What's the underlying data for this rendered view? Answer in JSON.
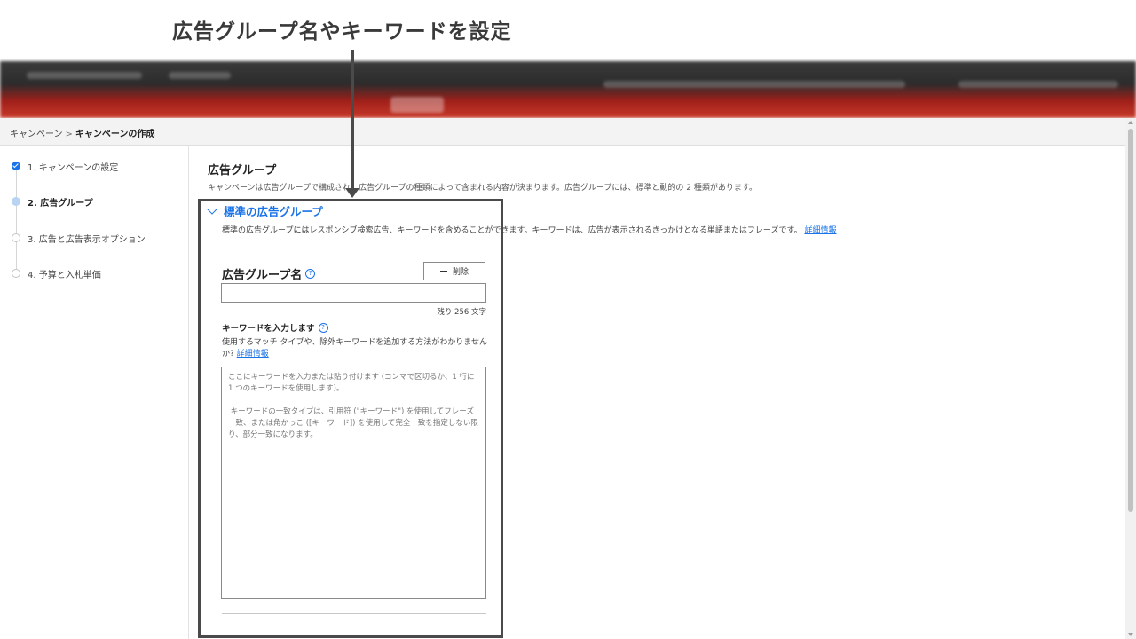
{
  "annotation": {
    "title": "広告グループ名やキーワードを設定"
  },
  "breadcrumb": {
    "parent": "キャンペーン",
    "separator": ">",
    "current": "キャンペーンの作成"
  },
  "steps": [
    {
      "label": "1. キャンペーンの設定",
      "status": "done"
    },
    {
      "label": "2. 広告グループ",
      "status": "active"
    },
    {
      "label": "3. 広告と広告表示オプション",
      "status": "todo"
    },
    {
      "label": "4. 予算と入札単価",
      "status": "todo"
    }
  ],
  "main": {
    "title": "広告グループ",
    "description": "キャンペーンは広告グループで構成され、広告グループの種類によって含まれる内容が決まります。広告グループには、標準と動的の 2 種類があります。"
  },
  "section": {
    "title": "標準の広告グループ",
    "description": "標準の広告グループにはレスポンシブ検索広告、キーワードを含めることができます。キーワードは、広告が表示されるきっかけとなる単語またはフレーズです。",
    "link": "詳細情報"
  },
  "ad_group": {
    "name_label": "広告グループ名",
    "help_icon": "?",
    "delete_label": "削除",
    "name_value": "",
    "char_remaining": "残り 256 文字"
  },
  "keywords": {
    "label": "キーワードを入力します",
    "help_text": "使用するマッチ タイプや、除外キーワードを追加する方法がわかりませんか?",
    "help_link": "詳細情報",
    "placeholder": "ここにキーワードを入力または貼り付けます (コンマで区切るか、1 行に 1 つのキーワードを使用します)。\n\n キーワードの一致タイプは、引用符 (\"キーワード\") を使用してフレーズ一致、または角かっこ ([キーワード]) を使用して完全一致を指定しない限り、部分一致になります。"
  },
  "colors": {
    "accent": "#1a73e8",
    "highlight_border": "#4a4a4a",
    "topbar_red": "#c83a2a"
  }
}
